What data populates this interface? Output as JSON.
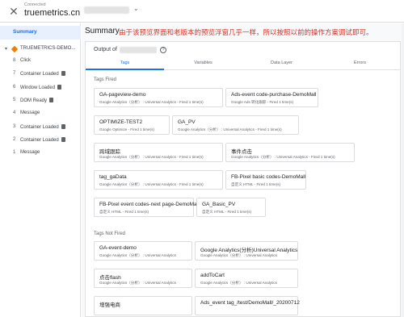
{
  "header": {
    "connected_label": "Connected",
    "domain": "truemetrics.cn"
  },
  "sidebar": {
    "summary_label": "Summary",
    "container_label": "TRUEMETRICS-DEMO...",
    "events": [
      {
        "num": "8",
        "label": "Click",
        "doc": false
      },
      {
        "num": "7",
        "label": "Container Loaded",
        "doc": true
      },
      {
        "num": "6",
        "label": "Window Loaded",
        "doc": true
      },
      {
        "num": "5",
        "label": "DOM Ready",
        "doc": true
      },
      {
        "num": "4",
        "label": "Message",
        "doc": false
      },
      {
        "num": "3",
        "label": "Container Loaded",
        "doc": true
      },
      {
        "num": "2",
        "label": "Container Loaded",
        "doc": true
      },
      {
        "num": "1",
        "label": "Message",
        "doc": false
      }
    ]
  },
  "main": {
    "title": "Summary",
    "annotation": "由于该预览界面和老版本的预览浮窗几乎一样，所以按照以前的操作方案调试即可。",
    "output_label": "Output of",
    "help_icon": "?",
    "tabs": [
      {
        "label": "Tags"
      },
      {
        "label": "Variables"
      },
      {
        "label": "Data Layer"
      },
      {
        "label": "Errors"
      }
    ],
    "fired_title": "Tags Fired",
    "fired": [
      {
        "title": "GA-pageview-demo",
        "sub": "Google Analytics（分析） : Universal Analytics - Fired 1 time(s)"
      },
      {
        "title": "Ads-event code-purchase-DemoMall",
        "sub": "Google Ads 转化跟踪 - Fired 1 time(s)"
      },
      {
        "title": "OPTIMIZE-TEST2",
        "sub": "Google Optimize - Fired 1 time(s)"
      },
      {
        "title": "GA_PV",
        "sub": "Google Analytics（分析） : Universal Analytics - Fired 1 time(s)"
      },
      {
        "title": "跨域跟踪",
        "sub": "Google Analytics（分析） : Universal Analytics - Fired 1 time(s)"
      },
      {
        "title": "事件点击",
        "sub": "Google Analytics（分析） : Universal Analytics - Fired 1 time(s)"
      },
      {
        "title": "tag_gaData",
        "sub": "Google Analytics（分析） : Universal Analytics - Fired 1 time(s)"
      },
      {
        "title": "FB-Pixel basic codes-DemoMall",
        "sub": "自定义 HTML - Fired 1 time(s)"
      },
      {
        "title": "FB-Pixel event codes-next page-DemoMall",
        "sub": "自定义 HTML - Fired 1 time(s)"
      },
      {
        "title": "GA_Basic_PV",
        "sub": "自定义 HTML - Fired 1 time(s)"
      }
    ],
    "notfired_title": "Tags Not Fired",
    "notfired": [
      {
        "title": "GA-event-demo",
        "sub": "Google Analytics（分析） : Universal Analytics"
      },
      {
        "title": "Google Analytics(分析)Universal Analytics",
        "sub": "Google Analytics（分析） : Universal Analytics"
      },
      {
        "title": "点击flash",
        "sub": "Google Analytics（分析） : Universal Analytics"
      },
      {
        "title": "addToCart",
        "sub": "Google Analytics（分析） : Universal Analytics"
      },
      {
        "title": "增强电商",
        "sub": ""
      },
      {
        "title": "Ads_event tag_/test/DemoMall/_20200712",
        "sub": ""
      }
    ]
  }
}
